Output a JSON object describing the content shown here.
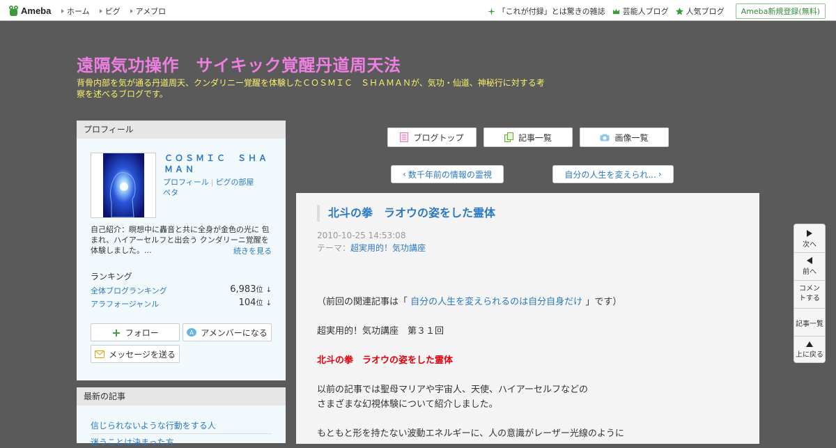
{
  "topbar": {
    "brand": "Ameba",
    "nav": [
      "ホーム",
      "ピグ",
      "アメブロ"
    ],
    "right_links": [
      "「これが付録」とは驚きの雑誌",
      "芸能人ブログ",
      "人気ブログ"
    ],
    "register": "Ameba新規登録(無料)"
  },
  "blog": {
    "title": "遠隔気功操作　サイキック覚醒丹道周天法",
    "description": "背骨内部を気が通る丹道周天、クンダリニー覚醒を体験したＣＯＳＭＩＣ　ＳＨＡＭＡＮが、気功・仙道、神秘行に対する考察を述べるブログです。"
  },
  "profile": {
    "header": "プロフィール",
    "name": "ＣＯＳＭＩＣ　ＳＨＡＭＡＮ",
    "link_profile": "プロフィール",
    "link_pig": "ピグの部屋",
    "link_peta": "ペタ",
    "intro": "自己紹介：瞑想中に轟音と共に全身が金色の光に 包まれ、ハイアーセルフと出会う クンダリーニ覚醒を体験しました。...",
    "more": "続きを見る",
    "ranking_title": "ランキング",
    "rankings": [
      {
        "label": "全体ブログランキング",
        "value": "6,983",
        "unit": "位",
        "arrow": "↓"
      },
      {
        "label": "アラフォージャンル",
        "value": "104",
        "unit": "位",
        "arrow": "↓"
      }
    ],
    "follow": "フォロー",
    "amember": "アメンバーになる",
    "message": "メッセージを送る"
  },
  "recent": {
    "header": "最新の記事",
    "items": [
      "信じられないような行動をする人",
      "迷うことは決まった方"
    ]
  },
  "tabs": {
    "top": "ブログトップ",
    "list": "記事一覧",
    "images": "画像一覧"
  },
  "pager": {
    "prev": "数千年前の情報の霊視",
    "next": "自分の人生を変えられ..."
  },
  "article": {
    "title": "北斗の拳　ラオウの姿をした霊体",
    "date": "2010-10-25 14:53:08",
    "theme_label": "テーマ：",
    "theme": "超実用的！気功講座",
    "related_prefix": "（前回の関連記事は「",
    "related_link": "自分の人生を変えられるのは自分自身だけ",
    "related_suffix": "」です）",
    "lecture": "超実用的！気功講座　第３１回",
    "heading": "北斗の拳　ラオウの姿をした霊体",
    "p1": "以前の記事では聖母マリアや宇宙人、天使、ハイアーセルフなどの",
    "p2": "さまざまな幻視体験について紹介しました。",
    "p3": "もともと形を持たない波動エネルギーに、人の意識がレーザー光線のように"
  },
  "floatnav": {
    "next": "次へ",
    "prev": "前へ",
    "comment": "コメントする",
    "list": "記事一覧",
    "top": "上に戻る"
  },
  "colors": {
    "title": "#ef7ee2",
    "description": "#f7f26b",
    "link": "#2b79c2",
    "background": "#5a5a5a",
    "accent_red": "#e1000f"
  }
}
